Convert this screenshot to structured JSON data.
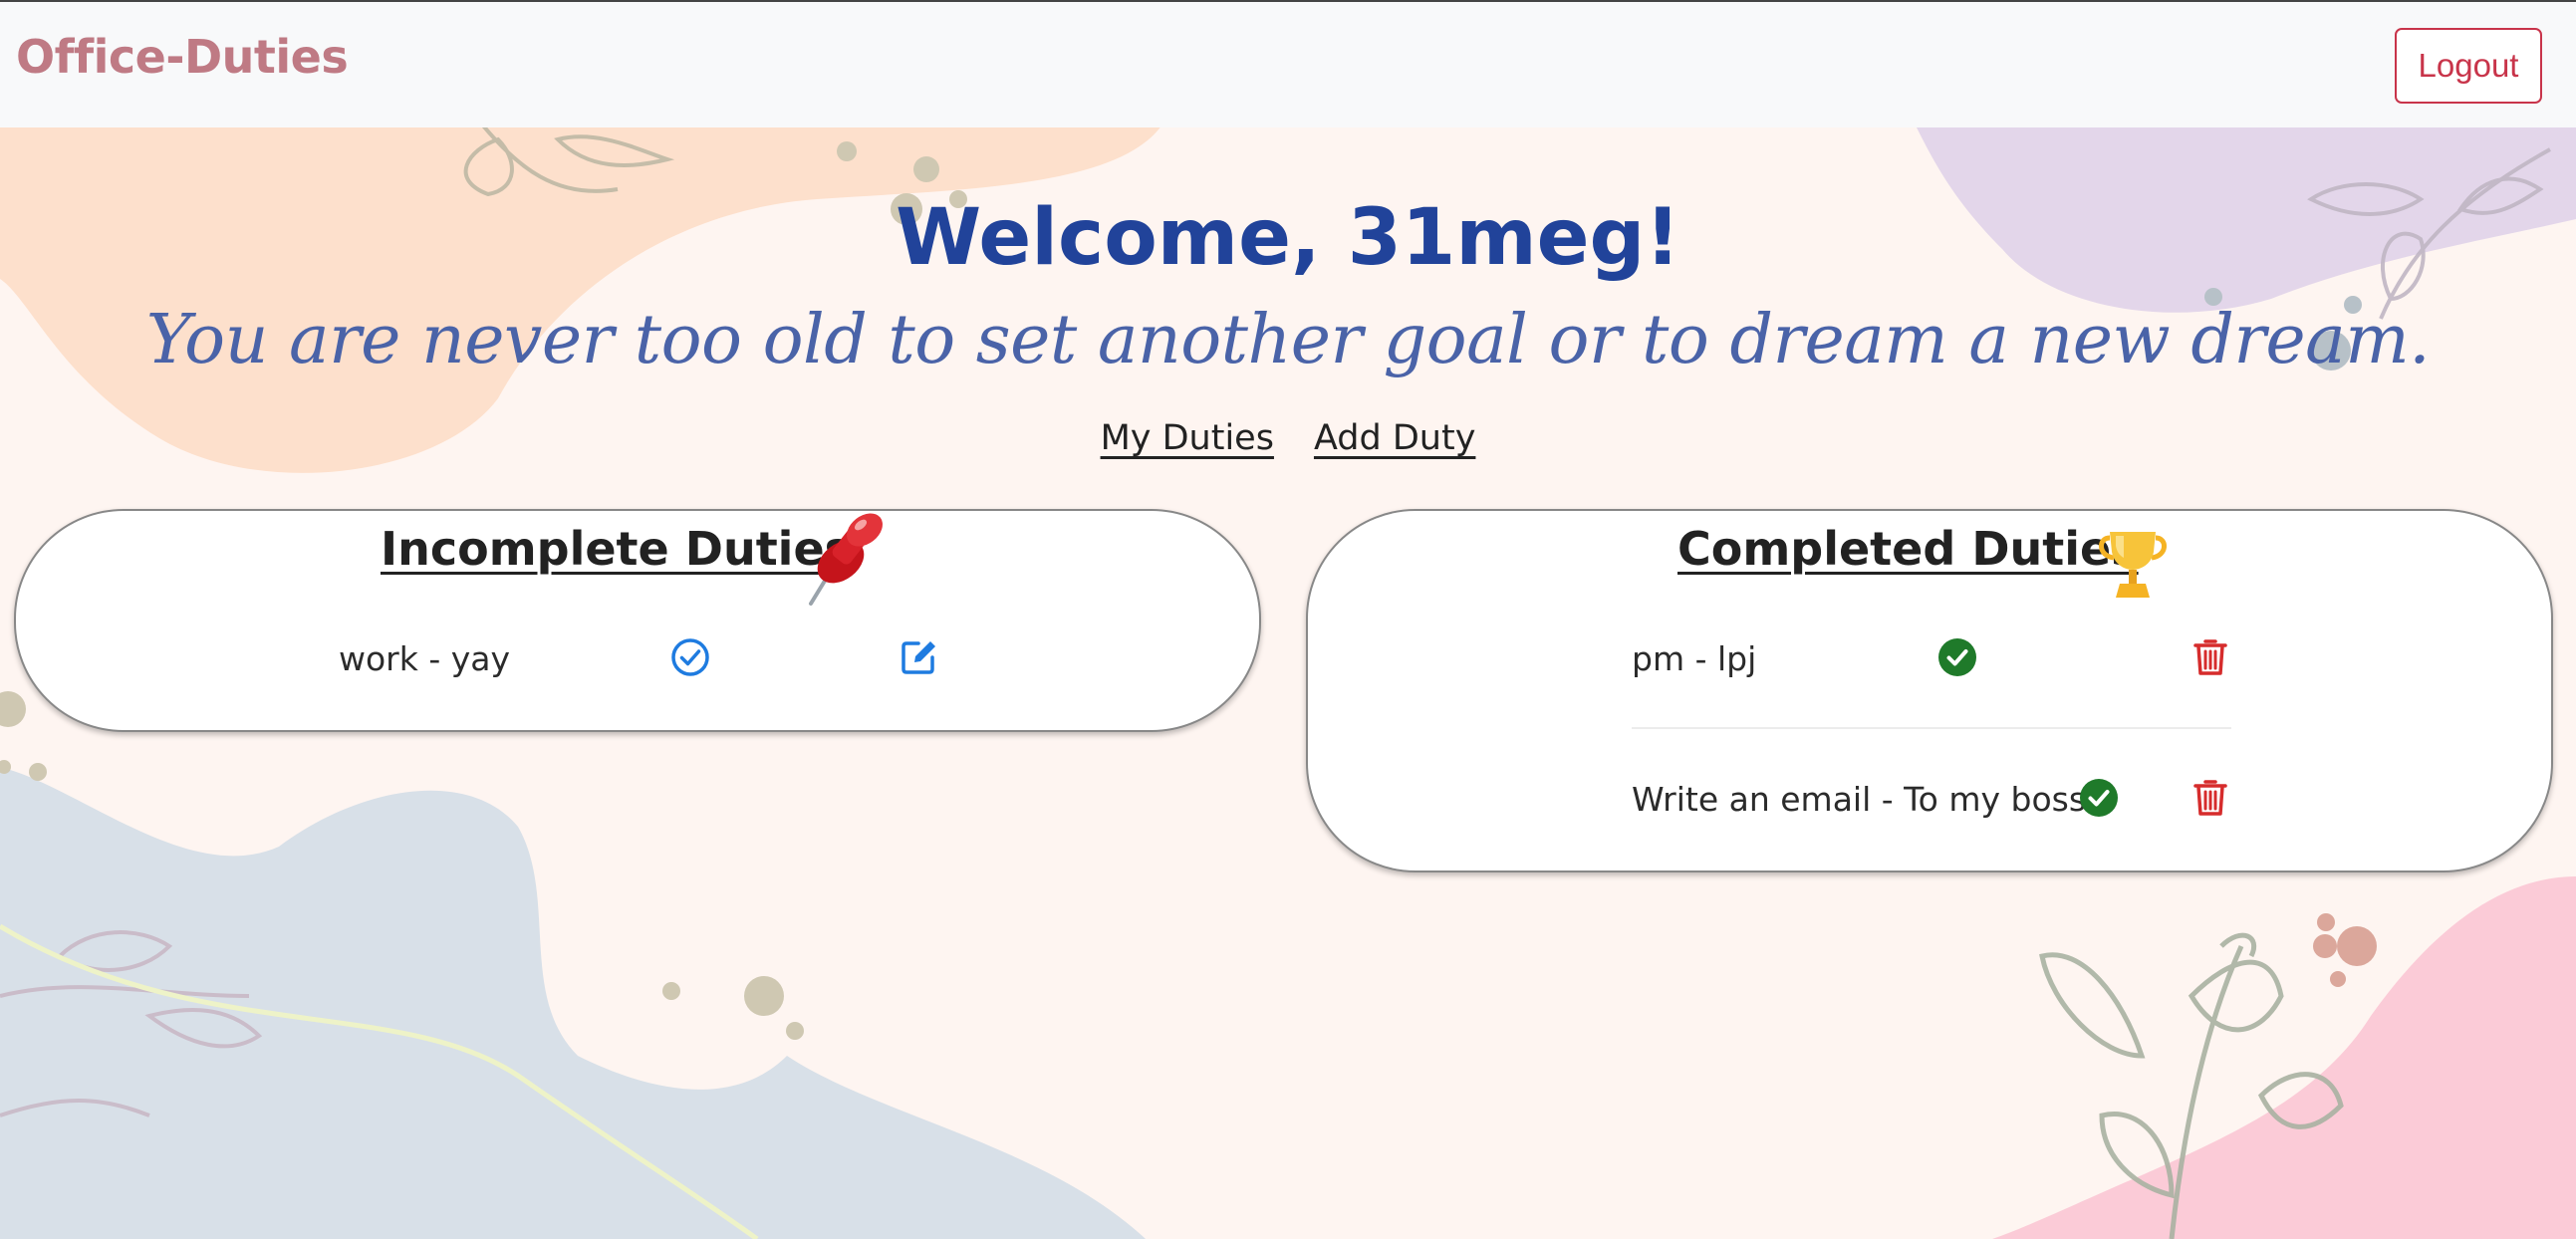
{
  "navbar": {
    "brand": "Office-Duties",
    "logout_label": "Logout"
  },
  "header": {
    "welcome": "Welcome, 31meg!",
    "quote": "You are never too old to set another goal or to dream a new dream."
  },
  "nav_links": {
    "my_duties": "My Duties",
    "add_duty": "Add Duty"
  },
  "incomplete": {
    "title": "Incomplete Duties",
    "title_icon": "pushpin-icon",
    "items": [
      {
        "text": "work - yay",
        "actions": [
          "check-circle-icon",
          "edit-icon"
        ]
      }
    ]
  },
  "completed": {
    "title": "Completed Duties",
    "title_icon": "trophy-icon",
    "items": [
      {
        "text": "pm - lpj",
        "actions": [
          "check-filled-icon",
          "trash-icon"
        ]
      },
      {
        "text": "Write an email - To my boss",
        "actions": [
          "check-filled-icon",
          "trash-icon"
        ]
      }
    ]
  },
  "colors": {
    "brand": "#bf7a84",
    "welcome": "#21439a",
    "quote": "#4a63a8",
    "logout": "#c8344a",
    "check_outline": "#1e7be0",
    "check_filled": "#1f7a2a",
    "trash": "#d62c2c"
  }
}
